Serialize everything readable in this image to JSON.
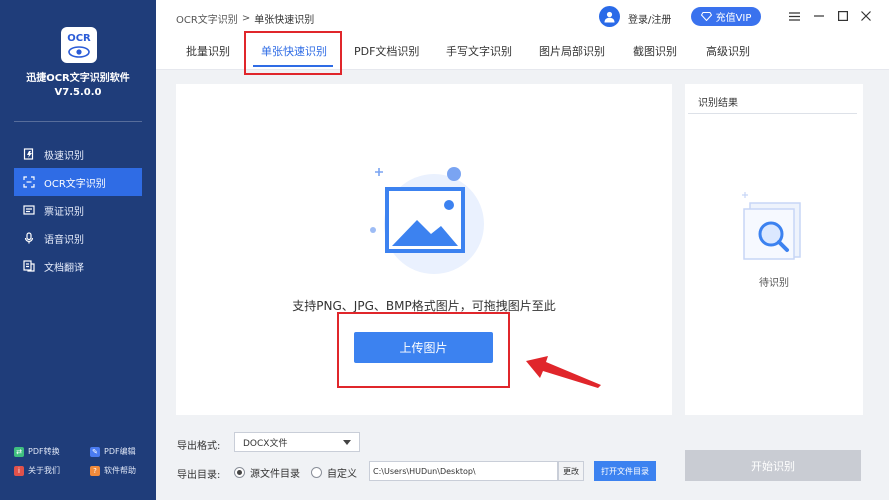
{
  "sidebar": {
    "logo_text": "OCR",
    "app_name": "迅捷OCR文字识别软件",
    "app_version": "V7.5.0.0",
    "menu": [
      {
        "label": "极速识别",
        "icon": "bolt-doc-icon"
      },
      {
        "label": "OCR文字识别",
        "icon": "scan-frame-icon",
        "active": true
      },
      {
        "label": "票证识别",
        "icon": "card-icon"
      },
      {
        "label": "语音识别",
        "icon": "microphone-icon"
      },
      {
        "label": "文档翻译",
        "icon": "translate-icon"
      }
    ],
    "bottom_links": [
      {
        "label": "PDF转换",
        "icon": "pdf-convert-icon",
        "color": "#3fbf7f"
      },
      {
        "label": "PDF编辑",
        "icon": "pdf-edit-icon",
        "color": "#4a7bf0"
      },
      {
        "label": "关于我们",
        "icon": "info-icon",
        "color": "#e0524b"
      },
      {
        "label": "软件帮助",
        "icon": "help-icon",
        "color": "#f08a3c"
      }
    ]
  },
  "topbar": {
    "breadcrumb_root": "OCR文字识别",
    "breadcrumb_sep": ">",
    "breadcrumb_current": "单张快速识别",
    "login_label": "登录/注册",
    "vip_label": "充值VIP"
  },
  "tabs": [
    {
      "label": "批量识别"
    },
    {
      "label": "单张快速识别",
      "active": true
    },
    {
      "label": "PDF文档识别"
    },
    {
      "label": "手写文字识别"
    },
    {
      "label": "图片局部识别"
    },
    {
      "label": "截图识别"
    },
    {
      "label": "高级识别"
    }
  ],
  "upload": {
    "hint": "支持PNG、JPG、BMP格式图片，可拖拽图片至此",
    "button_label": "上传图片"
  },
  "result": {
    "title": "识别结果",
    "waiting_label": "待识别"
  },
  "settings": {
    "export_format_label": "导出格式:",
    "export_format_value": "DOCX文件",
    "export_dir_label": "导出目录:",
    "radio_source": "源文件目录",
    "radio_custom": "自定义",
    "path_value": "C:\\Users\\HUDun\\Desktop\\",
    "change_label": "更改",
    "open_folder_label": "打开文件目录",
    "start_label": "开始识别"
  },
  "colors": {
    "sidebar_bg": "#1f3d7a",
    "accent": "#2f6ce5",
    "highlight_box": "#e0262b"
  }
}
